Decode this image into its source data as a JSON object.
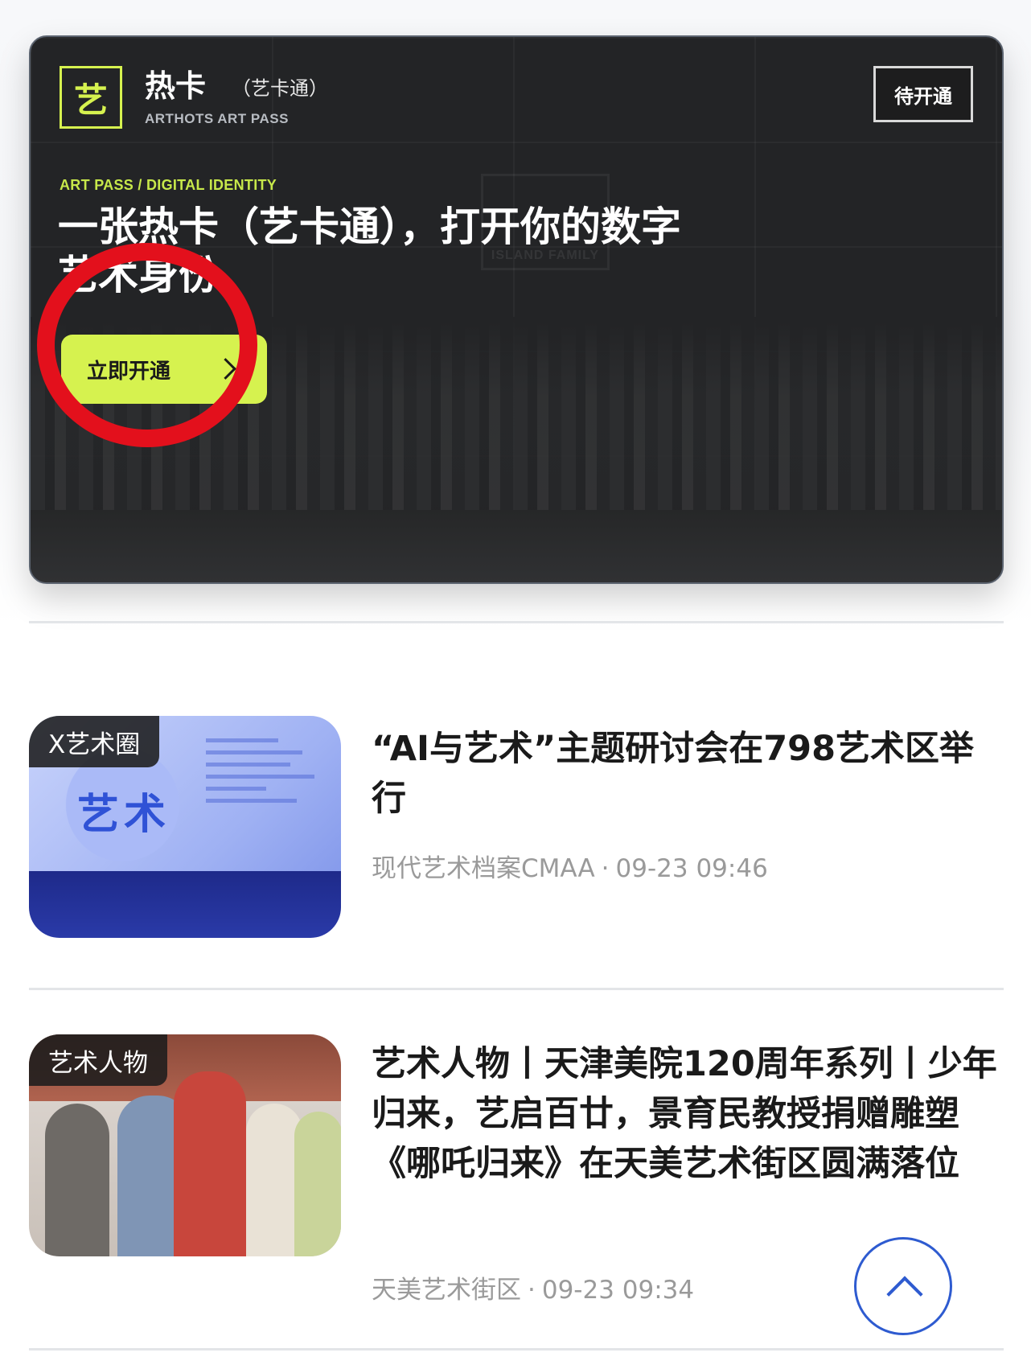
{
  "pass_card": {
    "logo_char": "艺",
    "brand_name": "热卡",
    "brand_sub": "（艺卡通）",
    "brand_en": "ARTHOTS ART PASS",
    "status_button": "待开通",
    "watermark": "ISLAND FAMILY",
    "tagline": "ART PASS / DIGITAL IDENTITY",
    "headline": "一张热卡（艺卡通），打开你的数字艺术身份",
    "cta_label": "立即开通",
    "accent_color": "#d6f24f",
    "highlight_annotation_color": "#e3101c"
  },
  "news": [
    {
      "tag": "X艺术圈",
      "thumb_text": "艺术",
      "title": "“AI与艺术”主题研讨会在798艺术区举行",
      "source": "现代艺术档案CMAA",
      "time": "09-23 09:46"
    },
    {
      "tag": "艺术人物",
      "title": "艺术人物丨天津美院120周年系列丨少年归来，艺启百廿，景育民教授捐赠雕塑《哪吒归来》在天美艺术街区圆满落位",
      "source": "天美艺术街区",
      "time": "09-23 09:34"
    }
  ],
  "meta_separator": "·",
  "back_to_top_icon": "chevron-up-icon"
}
